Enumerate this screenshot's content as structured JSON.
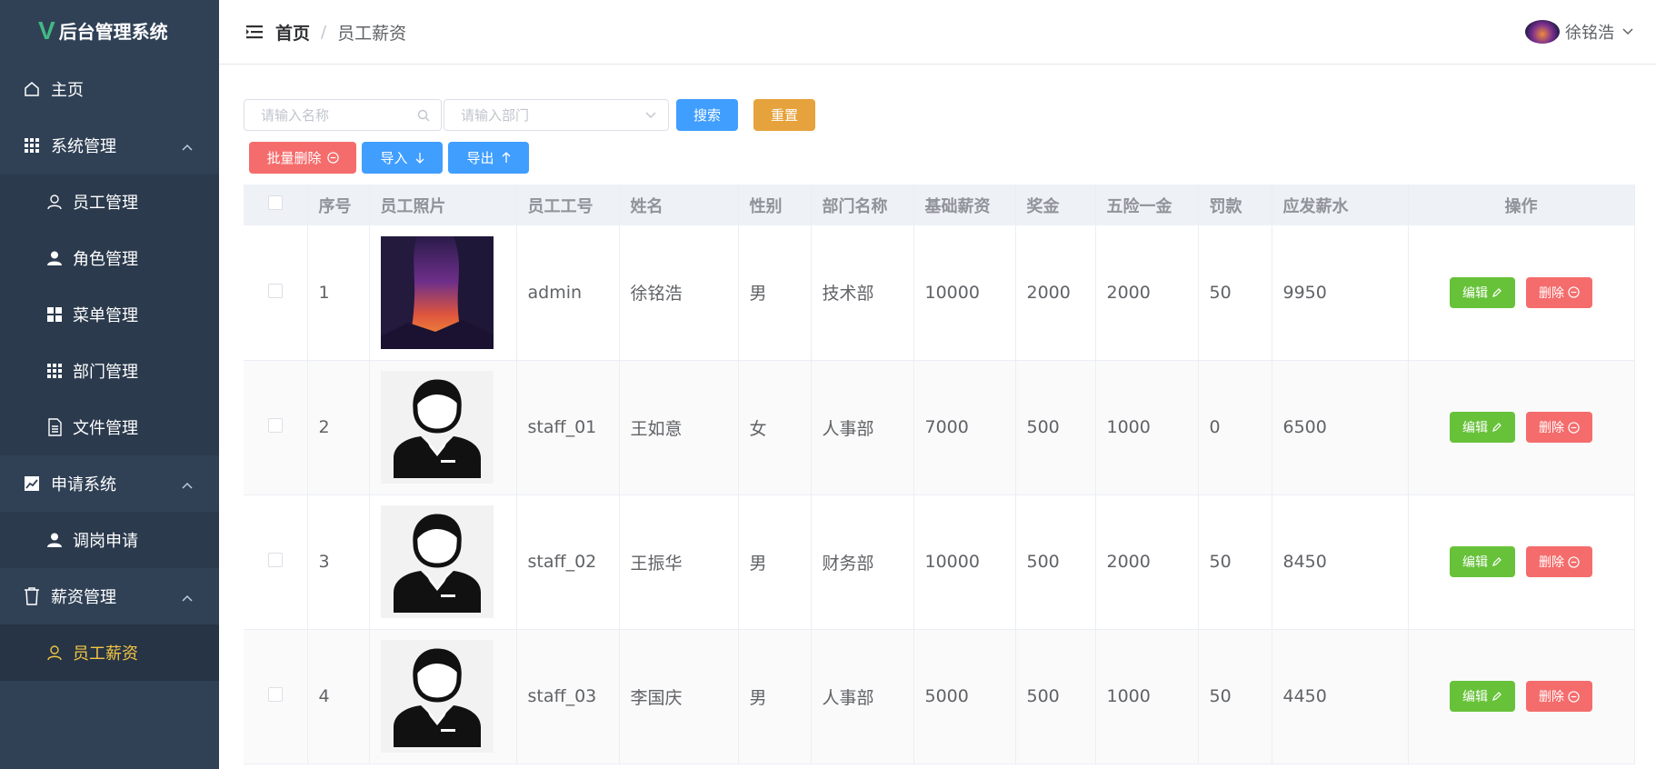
{
  "app": {
    "title": "后台管理系统",
    "logo_letter": "V"
  },
  "sidebar": {
    "items": [
      {
        "label": "主页",
        "icon": "home-icon"
      },
      {
        "label": "系统管理",
        "icon": "grid-icon",
        "expanded": true,
        "children": [
          {
            "label": "员工管理",
            "icon": "user-outline-icon"
          },
          {
            "label": "角色管理",
            "icon": "user-solid-icon"
          },
          {
            "label": "菜单管理",
            "icon": "menu-grid-icon"
          },
          {
            "label": "部门管理",
            "icon": "dots-grid-icon"
          },
          {
            "label": "文件管理",
            "icon": "document-icon"
          }
        ]
      },
      {
        "label": "申请系统",
        "icon": "chart-icon",
        "expanded": true,
        "children": [
          {
            "label": "调岗申请",
            "icon": "user-solid-icon"
          }
        ]
      },
      {
        "label": "薪资管理",
        "icon": "cup-icon",
        "expanded": true,
        "children": [
          {
            "label": "员工薪资",
            "icon": "user-outline-icon",
            "active": true
          }
        ]
      }
    ]
  },
  "header": {
    "breadcrumb_home": "首页",
    "breadcrumb_sep": "/",
    "breadcrumb_current": "员工薪资",
    "username": "徐铭浩"
  },
  "search": {
    "name_placeholder": "请输入名称",
    "dept_placeholder": "请输入部门",
    "search_label": "搜索",
    "reset_label": "重置"
  },
  "toolbar": {
    "batch_delete_label": "批量删除",
    "import_label": "导入",
    "export_label": "导出"
  },
  "table": {
    "columns": [
      "序号",
      "员工照片",
      "员工工号",
      "姓名",
      "性别",
      "部门名称",
      "基础薪资",
      "奖金",
      "五险一金",
      "罚款",
      "应发薪水",
      "操作"
    ],
    "edit_label": "编辑",
    "delete_label": "删除",
    "rows": [
      {
        "index": "1",
        "photo": "sunset-art",
        "emp_no": "admin",
        "name": "徐铭浩",
        "gender": "男",
        "dept": "技术部",
        "base": "10000",
        "bonus": "2000",
        "insurance": "2000",
        "fine": "50",
        "salary": "9950"
      },
      {
        "index": "2",
        "photo": "avatar-silhouette",
        "emp_no": "staff_01",
        "name": "王如意",
        "gender": "女",
        "dept": "人事部",
        "base": "7000",
        "bonus": "500",
        "insurance": "1000",
        "fine": "0",
        "salary": "6500"
      },
      {
        "index": "3",
        "photo": "avatar-silhouette",
        "emp_no": "staff_02",
        "name": "王振华",
        "gender": "男",
        "dept": "财务部",
        "base": "10000",
        "bonus": "500",
        "insurance": "2000",
        "fine": "50",
        "salary": "8450"
      },
      {
        "index": "4",
        "photo": "avatar-silhouette",
        "emp_no": "staff_03",
        "name": "李国庆",
        "gender": "男",
        "dept": "人事部",
        "base": "5000",
        "bonus": "500",
        "insurance": "1000",
        "fine": "50",
        "salary": "4450"
      }
    ]
  },
  "colors": {
    "sidebar_bg": "#304156",
    "active_text": "#f4c542",
    "primary": "#409eff",
    "success": "#67c23a",
    "danger": "#f56c6c",
    "warning": "#e6a23c",
    "logo_green": "#42b983"
  }
}
